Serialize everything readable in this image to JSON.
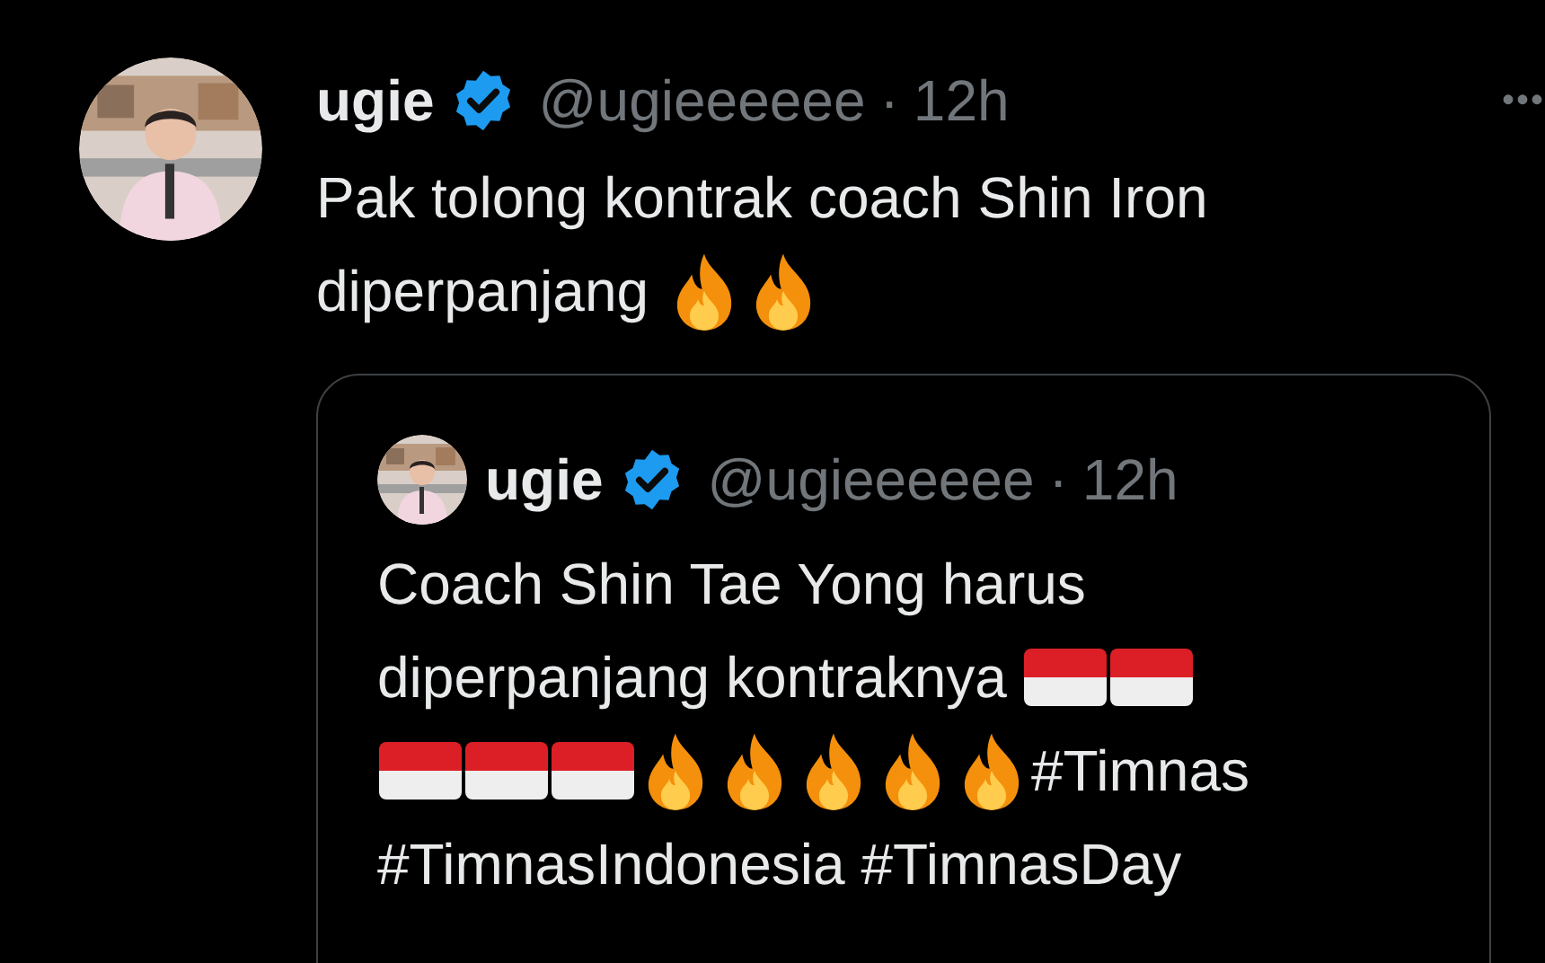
{
  "tweet": {
    "name": "ugie",
    "verified": true,
    "handle": "@ugieeeeee",
    "separator": "·",
    "time": "12h",
    "more": "•••",
    "lines": [
      [
        {
          "kind": "text",
          "text": "Pak tolong kontrak coach Shin Iron"
        }
      ],
      [
        {
          "kind": "text",
          "text": "diperpanjang "
        },
        {
          "kind": "fire"
        },
        {
          "kind": "fire"
        }
      ]
    ],
    "quote": {
      "name": "ugie",
      "verified": true,
      "handle": "@ugieeeeee",
      "separator": "·",
      "time": "12h",
      "lines": [
        [
          {
            "kind": "text",
            "text": "Coach Shin Tae Yong harus"
          }
        ],
        [
          {
            "kind": "text",
            "text": "diperpanjang kontraknya "
          },
          {
            "kind": "flag"
          },
          {
            "kind": "flag"
          }
        ],
        [
          {
            "kind": "flag"
          },
          {
            "kind": "flag"
          },
          {
            "kind": "flag"
          },
          {
            "kind": "fire"
          },
          {
            "kind": "fire"
          },
          {
            "kind": "fire"
          },
          {
            "kind": "fire"
          },
          {
            "kind": "fire"
          },
          {
            "kind": "text",
            "text": "#Timnas"
          }
        ],
        [
          {
            "kind": "text",
            "text": "#TimnasIndonesia #TimnasDay"
          }
        ]
      ]
    }
  }
}
